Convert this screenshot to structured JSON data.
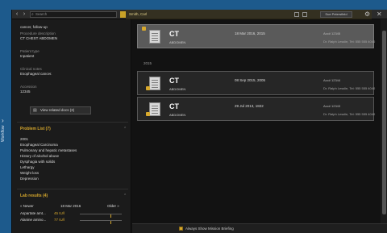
{
  "rail": {
    "label": "Workflow",
    "arrow": "›"
  },
  "toolbar": {
    "back_icon": "‹",
    "forward_icon": "›",
    "search_placeholder": "Search",
    "patient_label": "Smith, Carl",
    "user_button": "Sue Petersfield",
    "cog_icon": "⚙",
    "close_icon": "✕"
  },
  "sidebar": {
    "reason_label": "",
    "reason_value": "cancer, follow-up",
    "procedure_label": "Procedure description",
    "procedure_value": "CT CHEST ABDOMEN",
    "patient_type_label": "Patient type",
    "patient_type_value": "Inpatient",
    "clinical_label": "Clinical notes",
    "clinical_value": "Esophageal cancer.",
    "accession_label": "Accession",
    "accession_value": "12345",
    "related_button": "View related docs (3)",
    "problem_title": "Problem List (7)",
    "problems": [
      "2001",
      "Esophageal Carcinoma",
      "Pulmonary and hepatic metastases",
      "History of alcohol abuse",
      "Dysphagia with solids",
      "Lethargy",
      "Weight loss",
      "Depression"
    ],
    "labs_title": "Lab results (4)",
    "labs_prev": "« Newer",
    "labs_date": "18 Mar 2016",
    "labs_next": "Older »",
    "labs": [
      {
        "name": "Aspartate amt...",
        "value": "45 IU/l",
        "position": 0.74
      },
      {
        "name": "Alanine amino...",
        "value": "77 IU/l",
        "position": 0.74
      }
    ]
  },
  "studies": [
    {
      "modality": "CT",
      "body": "ABDOMEN",
      "date": "18 Mar 2016, 2015",
      "accession": "Acc# 12345",
      "physician": "Dr. Ralph Lesslie, Tel: 555 555 4040",
      "selected": true
    },
    {
      "modality": "CT",
      "body": "ABDOMEN",
      "date": "08 Sep 2015, 2005",
      "accession": "Acc# 12344",
      "physician": "Dr. Ralph Lesslie, Tel: 555 555 4040",
      "selected": false
    },
    {
      "modality": "CT",
      "body": "ABDOMEN",
      "date": "29 Jul 2013, 1822",
      "accession": "Acc# 12343",
      "physician": "Dr. Ralph Lesslie, Tel: 555 555 4040",
      "selected": false
    }
  ],
  "gap_label": "2015",
  "footer": {
    "checkbox_label": "Always Show Mission Briefing",
    "checked": true
  },
  "colors": {
    "accent": "#d8a92d",
    "desktop": "#1d5a8c"
  }
}
